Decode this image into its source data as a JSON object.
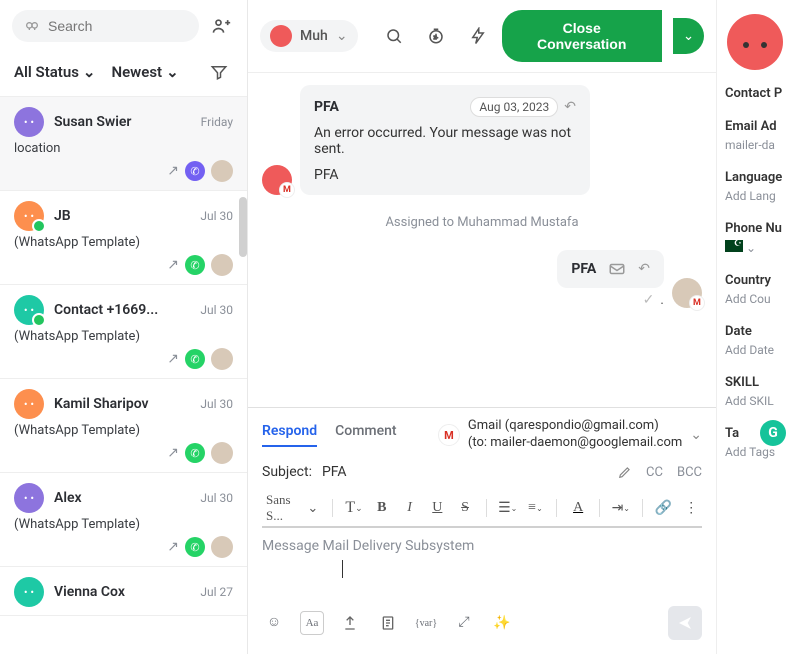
{
  "sidebar": {
    "search_placeholder": "Search",
    "filter_status": "All Status",
    "filter_sort": "Newest",
    "conversations": [
      {
        "name": "Susan Swier",
        "date": "Friday",
        "preview": "location",
        "avatar_color": "purple",
        "channel": "viber"
      },
      {
        "name": "JB",
        "date": "Jul 30",
        "preview": "(WhatsApp Template)",
        "avatar_color": "orange",
        "channel": "wa",
        "badge": true
      },
      {
        "name": "Contact +1669...",
        "date": "Jul 30",
        "preview": "(WhatsApp Template)",
        "avatar_color": "teal",
        "channel": "wa",
        "badge": true
      },
      {
        "name": "Kamil Sharipov",
        "date": "Jul 30",
        "preview": "(WhatsApp Template)",
        "avatar_color": "orange",
        "channel": "wa"
      },
      {
        "name": "Alex",
        "date": "Jul 30",
        "preview": "(WhatsApp Template)",
        "avatar_color": "purple",
        "channel": "wa"
      },
      {
        "name": "Vienna Cox",
        "date": "Jul 27",
        "preview": "",
        "avatar_color": "teal",
        "channel": ""
      }
    ]
  },
  "topbar": {
    "contact_name": "Muh",
    "close_label": "Close Conversation"
  },
  "thread": {
    "msg_in": {
      "subject": "PFA",
      "date": "Aug 03, 2023",
      "body": "An error occurred. Your message was not sent.",
      "footer": "PFA"
    },
    "assigned_text": "Assigned to Muhammad Mustafa",
    "msg_out": {
      "subject": "PFA",
      "body": "."
    }
  },
  "compose": {
    "tab_respond": "Respond",
    "tab_comment": "Comment",
    "from_line": "Gmail (qarespondio@gmail.com)",
    "to_line": "(to: mailer-daemon@googlemail.com",
    "subject_label": "Subject:",
    "subject_value": "PFA",
    "cc": "CC",
    "bcc": "BCC",
    "font_label": "Sans S...",
    "editor_placeholder": "Message Mail Delivery Subsystem"
  },
  "rpanel": {
    "title": "Contact P",
    "email_label": "Email Ad",
    "email_value": "mailer-da",
    "lang_label": "Language",
    "lang_value": "Add Lang",
    "phone_label": "Phone Nu",
    "country_label": "Country",
    "country_value": "Add Cou",
    "date_label": "Date",
    "date_value": "Add Date",
    "skill_label": "SKILL",
    "skill_value": "Add SKIL",
    "tags_label": "Ta",
    "tags_value": "Add Tags"
  }
}
